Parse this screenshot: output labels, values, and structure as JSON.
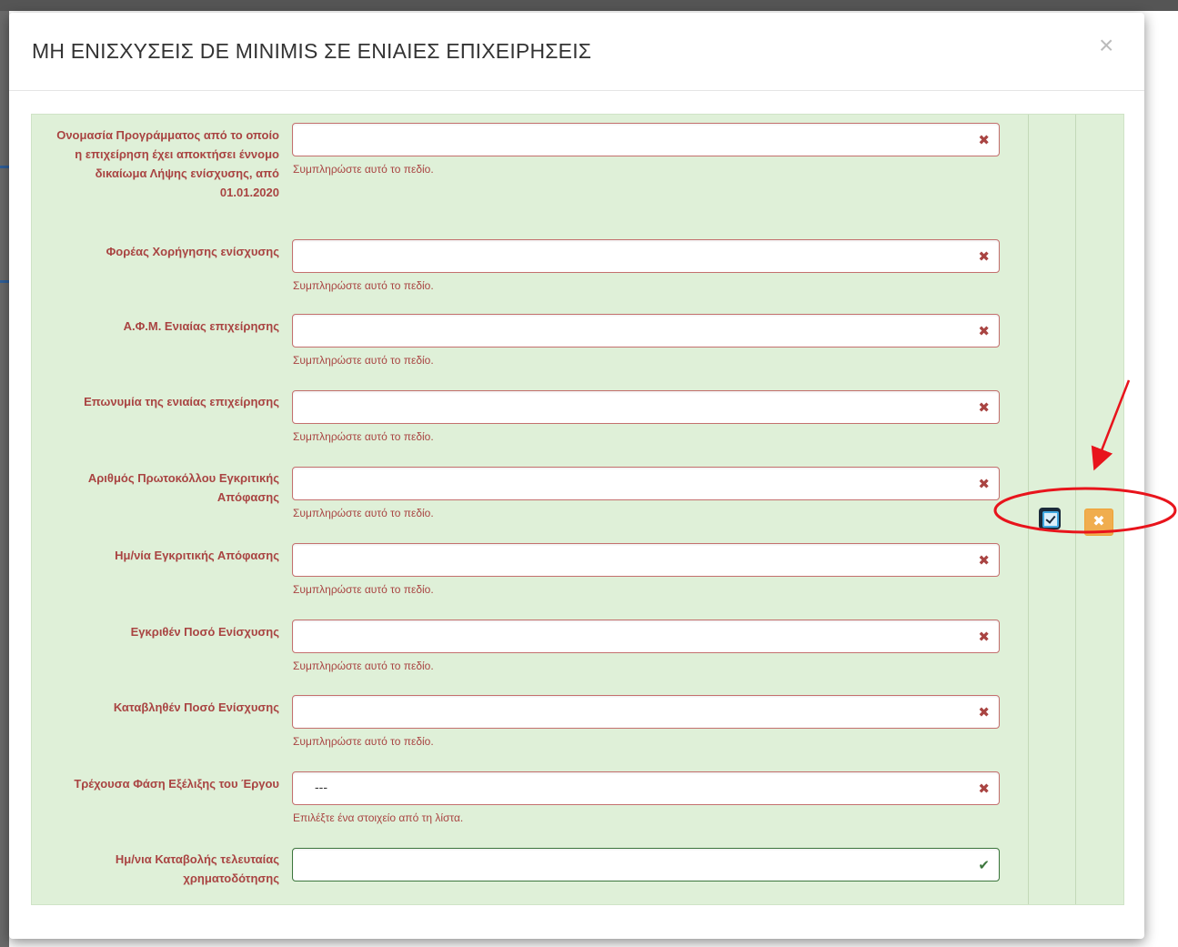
{
  "modal": {
    "title": "ΜΗ ΕΝΙΣΧΥΣΕΙΣ DE MINIMIS ΣΕ ΕΝΙΑΙΕΣ ΕΠΙΧΕΙΡΗΣΕΙΣ",
    "close_symbol": "×"
  },
  "form": {
    "fields": [
      {
        "label": "Ονομασία Προγράμματος από το οποίο η επιχείρηση έχει αποκτήσει έννομο δικαίωμα Λήψης ενίσχυσης, από 01.01.2020",
        "value": "",
        "help": "Συμπληρώστε αυτό το πεδίο.",
        "status": "error"
      },
      {
        "label": "Φορέας Χορήγησης ενίσχυσης",
        "value": "",
        "help": "Συμπληρώστε αυτό το πεδίο.",
        "status": "error"
      },
      {
        "label": "Α.Φ.Μ. Ενιαίας επιχείρησης",
        "value": "",
        "help": "Συμπληρώστε αυτό το πεδίο.",
        "status": "error"
      },
      {
        "label": "Επωνυμία της ενιαίας επιχείρησης",
        "value": "",
        "help": "Συμπληρώστε αυτό το πεδίο.",
        "status": "error"
      },
      {
        "label": "Αριθμός Πρωτοκόλλου Εγκριτικής Απόφασης",
        "value": "",
        "help": "Συμπληρώστε αυτό το πεδίο.",
        "status": "error"
      },
      {
        "label": "Ημ/νία Εγκριτικής Απόφασης",
        "value": "",
        "help": "Συμπληρώστε αυτό το πεδίο.",
        "status": "error"
      },
      {
        "label": "Εγκριθέν Ποσό Ενίσχυσης",
        "value": "",
        "help": "Συμπληρώστε αυτό το πεδίο.",
        "status": "error"
      },
      {
        "label": "Καταβληθέν Ποσό Ενίσχυσης",
        "value": "",
        "help": "Συμπληρώστε αυτό το πεδίο.",
        "status": "error"
      },
      {
        "label": "Τρέχουσα Φάση Εξέλιξης του Έργου",
        "value": "---",
        "help": "Επιλέξτε ένα στοιχείο από τη λίστα.",
        "status": "error"
      },
      {
        "label": "Ημ/νια Καταβολής τελευταίας χρηματοδότησης",
        "value": "",
        "help": "",
        "status": "ok"
      }
    ]
  },
  "icons": {
    "error": "close-icon",
    "ok": "check-icon",
    "edit": "edit-icon",
    "delete": "delete-icon"
  },
  "colors": {
    "panel_bg": "#dff0d8",
    "error": "#a94442",
    "success": "#3c763d",
    "warning_button": "#f0ad4e",
    "annotation": "#e8141c"
  }
}
